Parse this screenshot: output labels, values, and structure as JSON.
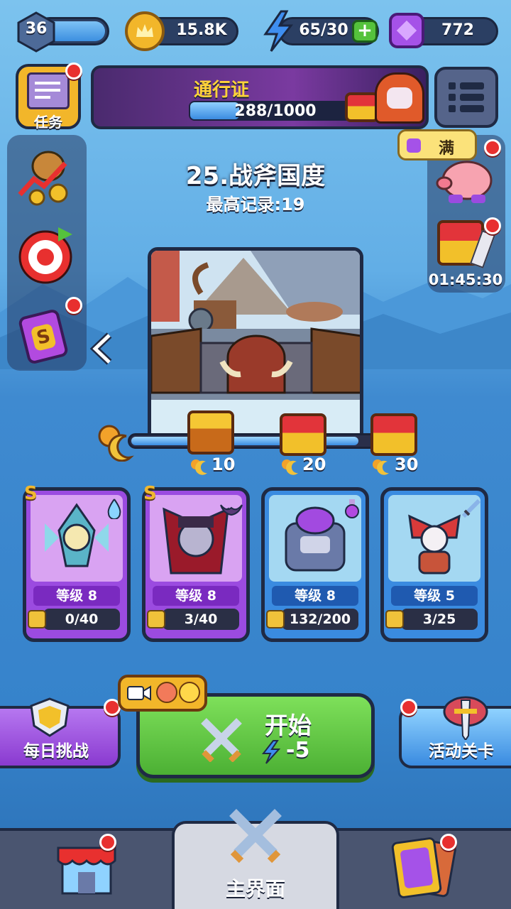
{
  "top_bar": {
    "level": "36",
    "gold": "15.8K",
    "energy": "65/30",
    "gems": "772"
  },
  "tasks": {
    "label": "任务"
  },
  "pass": {
    "title": "通行证",
    "progress_text": "288/1000",
    "progress": 0.288
  },
  "stage": {
    "title": "25.战斧国度",
    "best_record": "最高记录:19"
  },
  "piggy_bank": {
    "badge": "满"
  },
  "timer": {
    "countdown": "01:45:30"
  },
  "milestones": [
    {
      "value": "10"
    },
    {
      "value": "20"
    },
    {
      "value": "30"
    }
  ],
  "heroes": [
    {
      "rank": "S",
      "level": "等级 8",
      "progress": "0/40",
      "element_icon": "water-drop-icon"
    },
    {
      "rank": "S",
      "level": "等级 8",
      "progress": "3/40",
      "element_icon": "bat-icon"
    },
    {
      "rank": "",
      "level": "等级 8",
      "progress": "132/200",
      "element_icon": "potion-icon"
    },
    {
      "rank": "",
      "level": "等级 5",
      "progress": "3/25",
      "element_icon": "sword-icon"
    }
  ],
  "actions": {
    "daily_challenge": "每日挑战",
    "start": "开始",
    "start_cost": "-5",
    "event_stage": "活动关卡"
  },
  "bottom_nav": {
    "main": "主界面"
  },
  "colors": {
    "accent_green": "#55c23c",
    "accent_purple": "#9b4be0",
    "gold": "#f2b62a",
    "sky": "#62aee6"
  }
}
